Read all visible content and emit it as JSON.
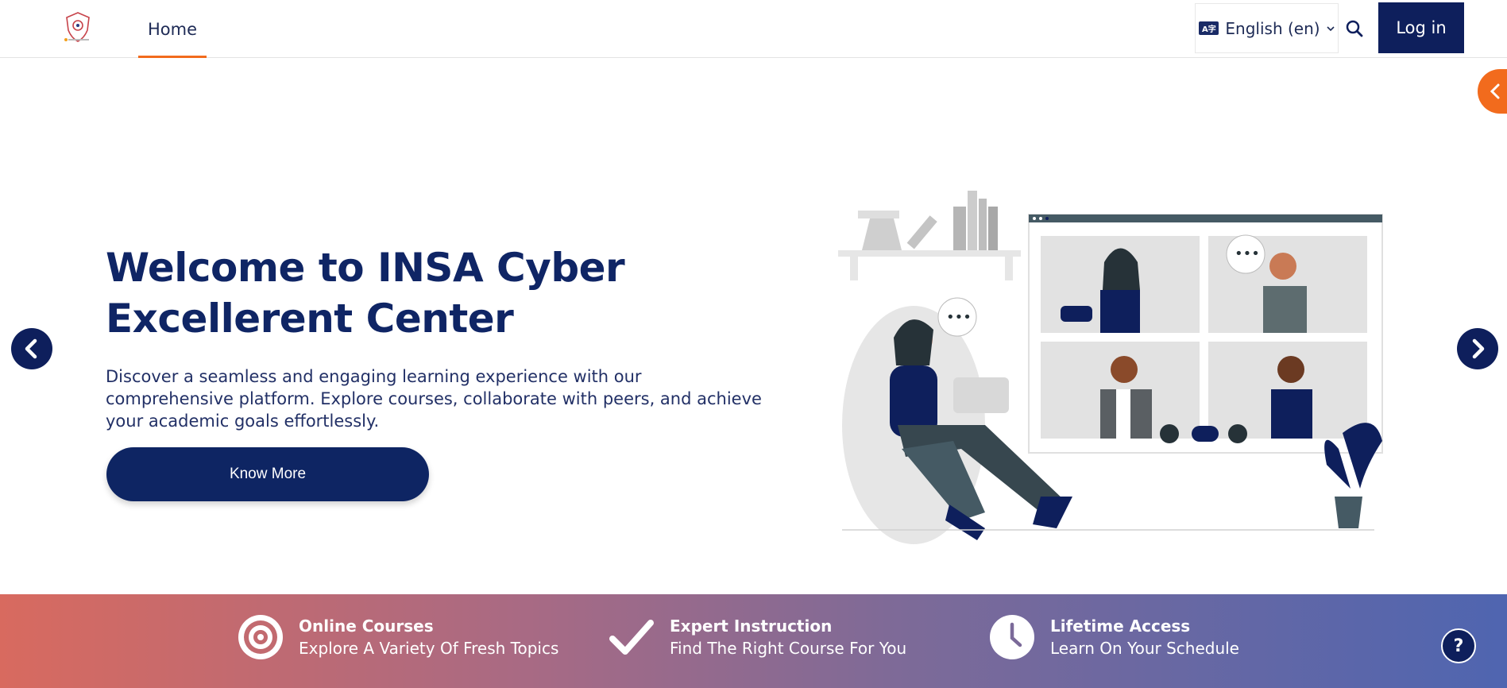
{
  "nav": {
    "home_label": "Home",
    "language_label": "English (en)",
    "login_label": "Log in"
  },
  "hero": {
    "title_line1": "Welcome to INSA Cyber",
    "title_line2": "Excellerent Center",
    "description": "Discover a seamless and engaging learning experience with our comprehensive platform. Explore courses, collaborate with peers, and achieve your academic goals effortlessly.",
    "button_label": "Know More"
  },
  "features": [
    {
      "title": "Online Courses",
      "subtitle": "Explore A Variety Of Fresh Topics",
      "icon": "target-icon"
    },
    {
      "title": "Expert Instruction",
      "subtitle": "Find The Right Course For You",
      "icon": "check-icon"
    },
    {
      "title": "Lifetime Access",
      "subtitle": "Learn On Your Schedule",
      "icon": "clock-icon"
    }
  ],
  "help_label": "?",
  "colors": {
    "brand_navy": "#0e1f5c",
    "accent_orange": "#f26b1d",
    "gradient_start": "#d86a5f",
    "gradient_end": "#4f65b0"
  }
}
